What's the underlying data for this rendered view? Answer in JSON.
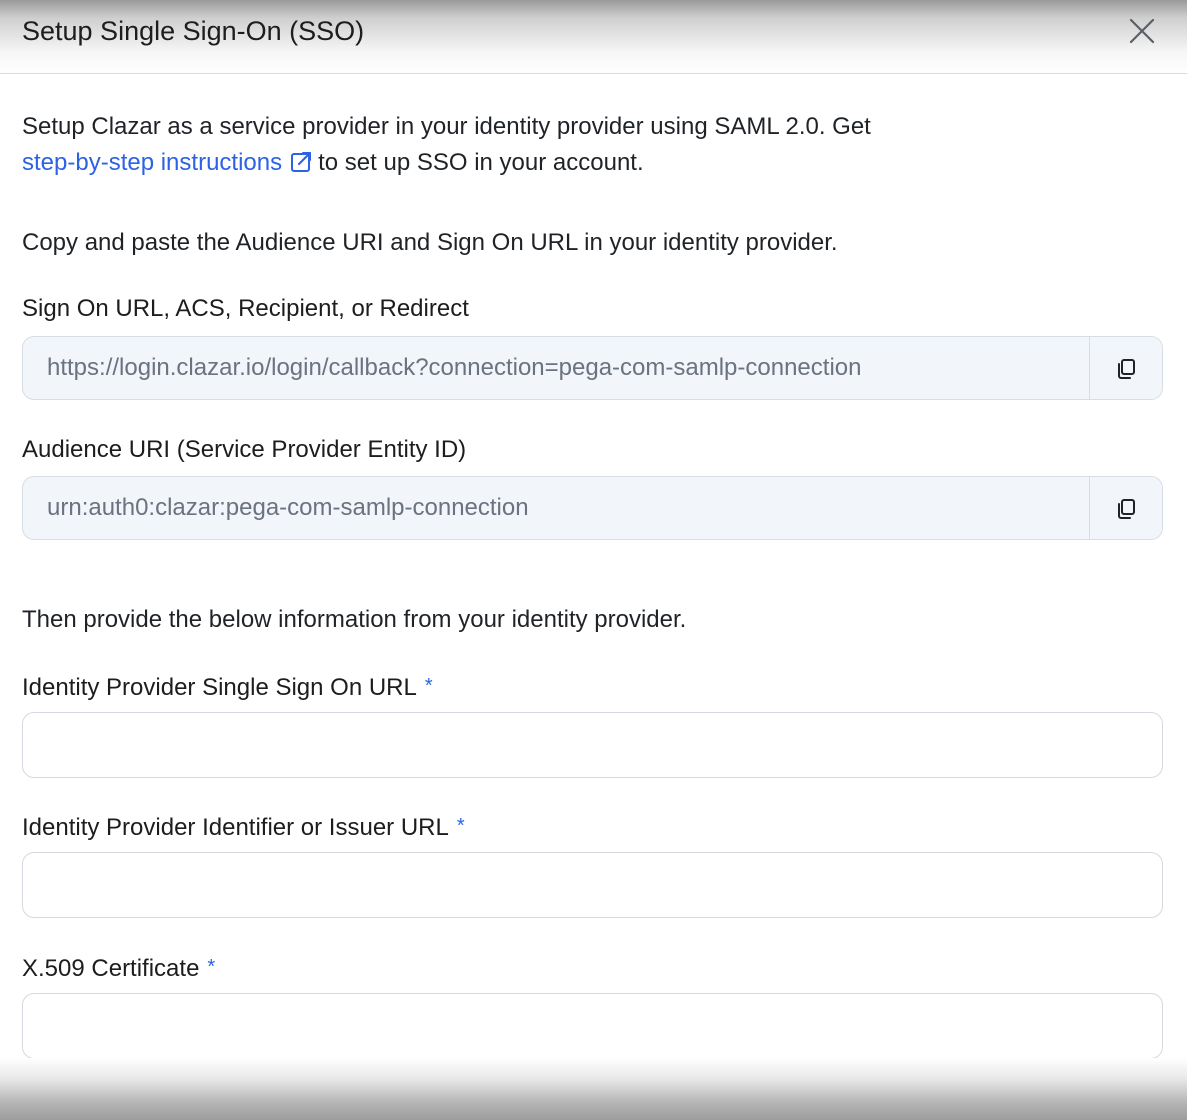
{
  "dialog": {
    "title": "Setup Single Sign-On (SSO)"
  },
  "intro": {
    "text_before": "Setup Clazar as a service provider in your identity provider using SAML 2.0. Get ",
    "link_label": "step-by-step instructions",
    "text_after": "to set up SSO in your account."
  },
  "copy_section": {
    "instruction": "Copy and paste the Audience URI and Sign On URL in your identity provider.",
    "sign_on_url": {
      "label": "Sign On URL, ACS, Recipient, or Redirect",
      "value": "https://login.clazar.io/login/callback?connection=pega-com-samlp-connection"
    },
    "audience_uri": {
      "label": "Audience URI (Service Provider Entity ID)",
      "value": "urn:auth0:clazar:pega-com-samlp-connection"
    }
  },
  "provide_section": {
    "instruction": "Then provide the below information from your identity provider.",
    "required_marker": "*",
    "idp_sso_url": {
      "label": "Identity Provider Single Sign On URL",
      "value": ""
    },
    "idp_issuer_url": {
      "label": "Identity Provider Identifier or Issuer URL",
      "value": ""
    },
    "x509_certificate": {
      "label": "X.509 Certificate",
      "value": ""
    }
  },
  "colors": {
    "link": "#2b63e4",
    "required": "#2b63e4",
    "readonly_field_bg": "#f2f5f9"
  },
  "icons": {
    "close": "close-icon",
    "external_link": "external-link-icon",
    "copy": "copy-icon"
  }
}
